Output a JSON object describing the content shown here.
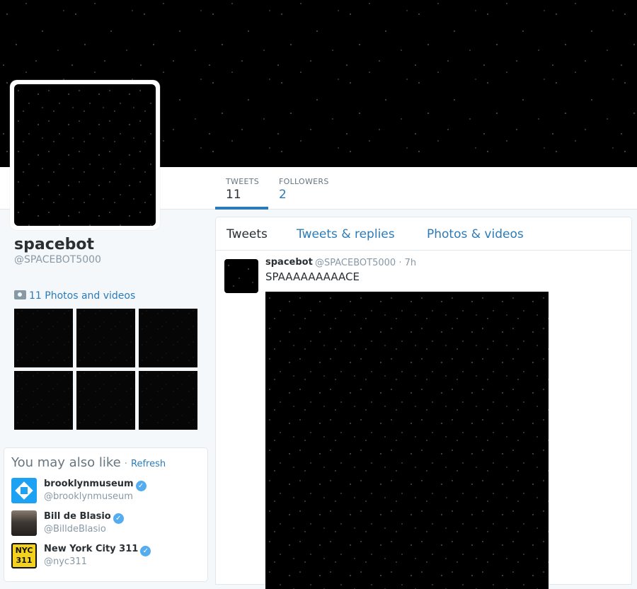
{
  "banner": {
    "alt": "starfield header"
  },
  "profile": {
    "name": "spacebot",
    "handle": "@SPACEBOT5000"
  },
  "stats": {
    "tweets_label": "TWEETS",
    "tweets_value": "11",
    "followers_label": "FOLLOWERS",
    "followers_value": "2"
  },
  "photos": {
    "link_label": "11 Photos and videos",
    "icon": "camera-icon"
  },
  "suggestions": {
    "title": "You may also like",
    "separator": "·",
    "refresh_label": "Refresh",
    "items": [
      {
        "name": "brooklynmuseum",
        "handle": "@brooklynmuseum",
        "verified": true
      },
      {
        "name": "Bill de Blasio",
        "handle": "@BilldeBlasio",
        "verified": true
      },
      {
        "name": "New York City 311",
        "handle": "@nyc311",
        "verified": true,
        "logo_text_1": "NYC",
        "logo_text_2": "311"
      }
    ]
  },
  "stream": {
    "tabs": [
      "Tweets",
      "Tweets & replies",
      "Photos & videos"
    ],
    "tweet": {
      "author_name": "spacebot",
      "author_handle": "@SPACEBOT5000",
      "separator": "·",
      "time": "7h",
      "text": "SPAAAAAAAAACE"
    }
  },
  "colors": {
    "accent": "#2b7bb9",
    "verified": "#55acee",
    "muted": "#8899a6"
  }
}
